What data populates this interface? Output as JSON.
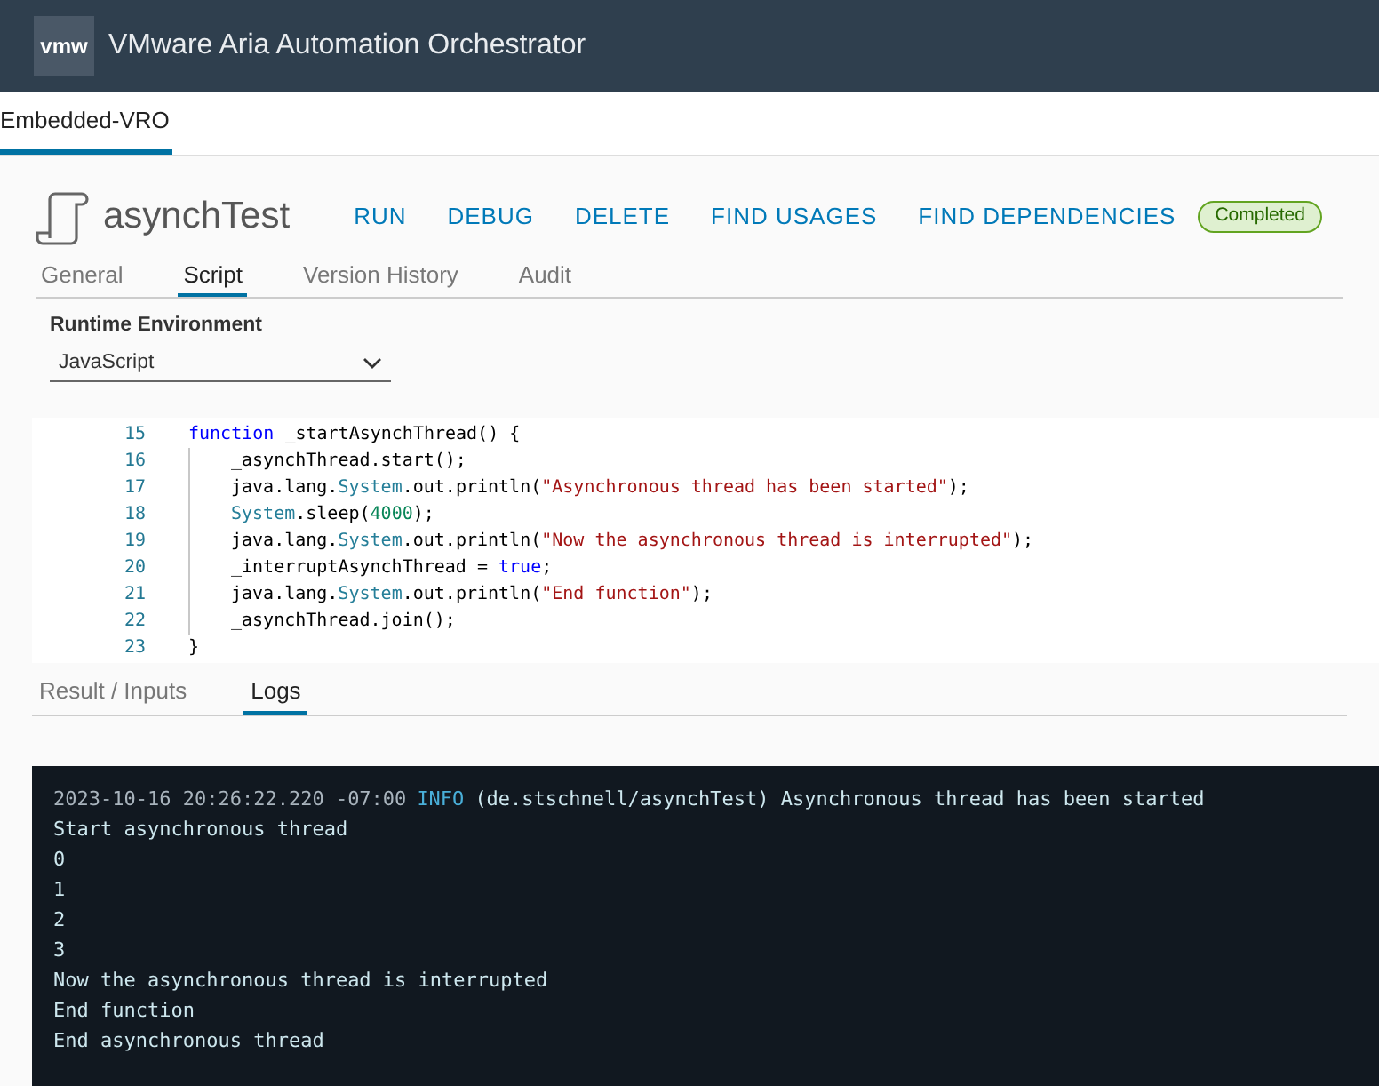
{
  "header": {
    "logo": "vmw",
    "title": "VMware Aria Automation Orchestrator"
  },
  "top_tabs": [
    {
      "label": "Embedded-VRO",
      "selected": true
    }
  ],
  "workflow": {
    "name": "asynchTest",
    "actions": [
      "RUN",
      "DEBUG",
      "DELETE",
      "FIND USAGES",
      "FIND DEPENDENCIES"
    ],
    "status": "Completed"
  },
  "tabs": [
    {
      "label": "General",
      "selected": false
    },
    {
      "label": "Script",
      "selected": true
    },
    {
      "label": "Version History",
      "selected": false
    },
    {
      "label": "Audit",
      "selected": false
    }
  ],
  "runtime": {
    "label": "Runtime Environment",
    "value": "JavaScript"
  },
  "code": [
    {
      "number": "15",
      "tokens": [
        {
          "kind": "keyword",
          "text": "function"
        },
        {
          "kind": "plain",
          "text": " _startAsynchThread() {"
        }
      ],
      "children": [
        {
          "number": "16",
          "tokens": [
            {
              "kind": "plain",
              "text": "_asynchThread.start();"
            }
          ]
        },
        {
          "number": "17",
          "tokens": [
            {
              "kind": "plain",
              "text": "java.lang."
            },
            {
              "kind": "type",
              "text": "System"
            },
            {
              "kind": "plain",
              "text": ".out.println("
            },
            {
              "kind": "string",
              "text": "\"Asynchronous thread has been started\""
            },
            {
              "kind": "plain",
              "text": ");"
            }
          ]
        },
        {
          "number": "18",
          "tokens": [
            {
              "kind": "type",
              "text": "System"
            },
            {
              "kind": "plain",
              "text": ".sleep("
            },
            {
              "kind": "number",
              "text": "4000"
            },
            {
              "kind": "plain",
              "text": ");"
            }
          ]
        },
        {
          "number": "19",
          "tokens": [
            {
              "kind": "plain",
              "text": "java.lang."
            },
            {
              "kind": "type",
              "text": "System"
            },
            {
              "kind": "plain",
              "text": ".out.println("
            },
            {
              "kind": "string",
              "text": "\"Now the asynchronous thread is interrupted\""
            },
            {
              "kind": "plain",
              "text": ");"
            }
          ]
        },
        {
          "number": "20",
          "tokens": [
            {
              "kind": "plain",
              "text": "_interruptAsynchThread = "
            },
            {
              "kind": "keyword",
              "text": "true"
            },
            {
              "kind": "plain",
              "text": ";"
            }
          ]
        },
        {
          "number": "21",
          "tokens": [
            {
              "kind": "plain",
              "text": "java.lang."
            },
            {
              "kind": "type",
              "text": "System"
            },
            {
              "kind": "plain",
              "text": ".out.println("
            },
            {
              "kind": "string",
              "text": "\"End function\""
            },
            {
              "kind": "plain",
              "text": ");"
            }
          ]
        },
        {
          "number": "22",
          "tokens": [
            {
              "kind": "plain",
              "text": "_asynchThread.join();"
            }
          ]
        }
      ]
    },
    {
      "number": "23",
      "tokens": [
        {
          "kind": "plain",
          "text": "}"
        }
      ]
    }
  ],
  "bottom_tabs": [
    {
      "label": "Result / Inputs",
      "selected": false
    },
    {
      "label": "Logs",
      "selected": true
    }
  ],
  "logs": [
    {
      "segments": [
        {
          "kind": "timestamp",
          "text": "2023-10-16 20:26:22.220 -07:00"
        },
        {
          "kind": "level",
          "text": "INFO"
        },
        {
          "kind": "message",
          "text": "(de.stschnell/asynchTest) Asynchronous thread has been started"
        }
      ]
    },
    {
      "segments": [
        {
          "kind": "message",
          "text": "Start asynchronous thread"
        }
      ]
    },
    {
      "segments": [
        {
          "kind": "message",
          "text": "0"
        }
      ]
    },
    {
      "segments": [
        {
          "kind": "message",
          "text": "1"
        }
      ]
    },
    {
      "segments": [
        {
          "kind": "message",
          "text": "2"
        }
      ]
    },
    {
      "segments": [
        {
          "kind": "message",
          "text": "3"
        }
      ]
    },
    {
      "segments": [
        {
          "kind": "message",
          "text": "Now the asynchronous thread is interrupted"
        }
      ]
    },
    {
      "segments": [
        {
          "kind": "message",
          "text": "End function"
        }
      ]
    },
    {
      "segments": [
        {
          "kind": "message",
          "text": "End asynchronous thread"
        }
      ]
    }
  ]
}
